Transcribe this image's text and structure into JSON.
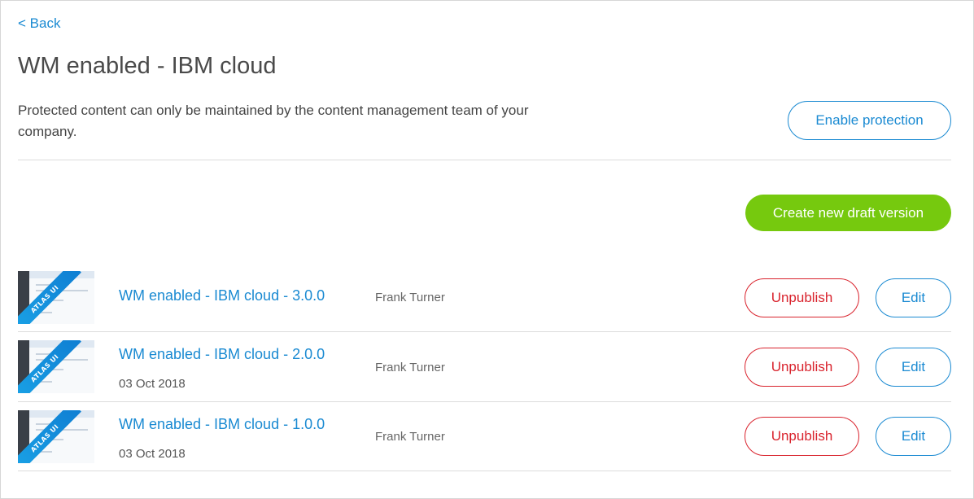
{
  "nav": {
    "back_label": "< Back"
  },
  "page": {
    "title": "WM enabled - IBM cloud",
    "description": "Protected content can only be maintained by the content management team of your company.",
    "enable_protection_label": "Enable protection",
    "create_draft_label": "Create new draft version"
  },
  "versions": [
    {
      "name": "WM enabled - IBM cloud - 3.0.0",
      "date": "",
      "author": "Frank Turner",
      "thumb_badge": "ATLAS UI",
      "unpublish_label": "Unpublish",
      "edit_label": "Edit"
    },
    {
      "name": "WM enabled - IBM cloud - 2.0.0",
      "date": "03 Oct 2018",
      "author": "Frank Turner",
      "thumb_badge": "ATLAS UI",
      "unpublish_label": "Unpublish",
      "edit_label": "Edit"
    },
    {
      "name": "WM enabled - IBM cloud - 1.0.0",
      "date": "03 Oct 2018",
      "author": "Frank Turner",
      "thumb_badge": "ATLAS UI",
      "unpublish_label": "Unpublish",
      "edit_label": "Edit"
    }
  ],
  "colors": {
    "link_blue": "#1a8ad2",
    "danger_red": "#d9232d",
    "primary_green": "#76c90e",
    "ribbon_blue": "#1aa2e6"
  }
}
